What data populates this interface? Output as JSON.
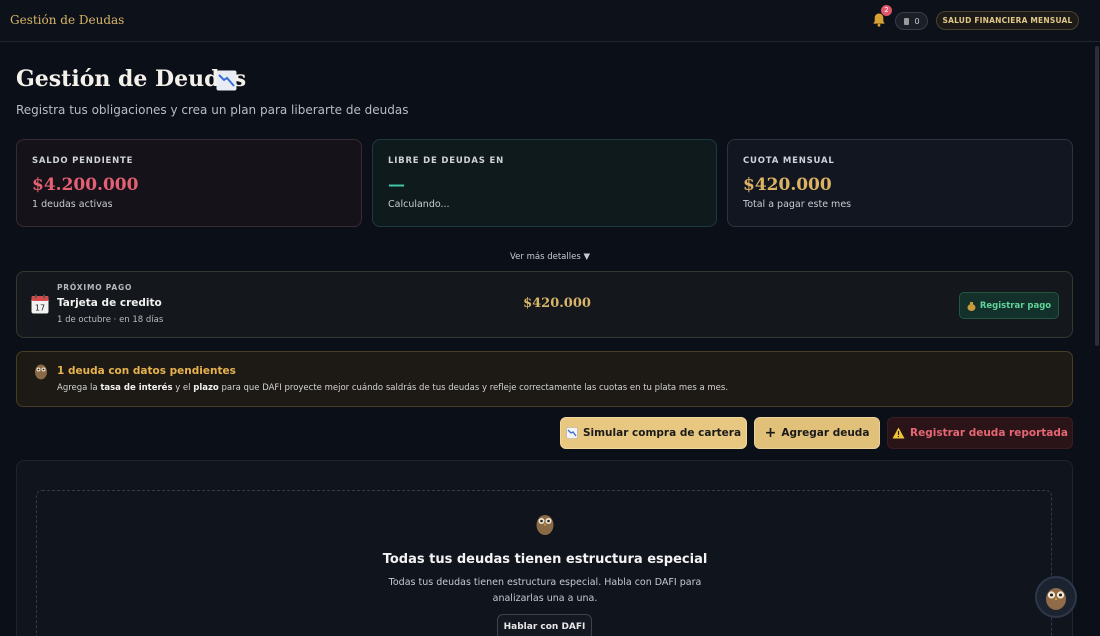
{
  "header": {
    "brand": "Gestión de Deudas",
    "notification_count": "2",
    "points": "0",
    "health_button": "SALUD FINANCIERA MENSUAL"
  },
  "page": {
    "title": "Gestión de Deudas",
    "subtitle": "Registra tus obligaciones y crea un plan para liberarte de deudas"
  },
  "cards": [
    {
      "label": "SALDO PENDIENTE",
      "value": "$4.200.000",
      "note": "1 deudas activas",
      "color": "#e46072"
    },
    {
      "label": "LIBRE DE DEUDAS EN",
      "value": "—",
      "note": "Calculando...",
      "color": "#3fc6a6"
    },
    {
      "label": "CUOTA MENSUAL",
      "value": "$420.000",
      "note": "Total a pagar este mes",
      "color": "#dcb363"
    }
  ],
  "more_details": "Ver más detalles ▼",
  "next_payment": {
    "label": "PRÓXIMO PAGO",
    "name": "Tarjeta de credito",
    "date": "1 de octubre · en 18 días",
    "amount": "$420.000",
    "button": "Registrar pago",
    "calendar_day": "17"
  },
  "alert": {
    "title": "1 deuda con datos pendientes",
    "body_1": "Agrega la ",
    "body_2": "tasa de interés",
    "body_3": " y el ",
    "body_4": "plazo",
    "body_5": " para que DAFI proyecte mejor cuándo saldrás de tus deudas y refleje correctamente las cuotas en tu plata mes a mes."
  },
  "actions": {
    "simulate": "Simular compra de cartera",
    "add": "Agregar deuda",
    "report": "Registrar deuda reportada"
  },
  "empty_state": {
    "title": "Todas tus deudas tienen estructura especial",
    "text": "Todas tus deudas tienen estructura especial. Habla con DAFI para analizarlas una a una.",
    "button": "Hablar con DAFI"
  }
}
